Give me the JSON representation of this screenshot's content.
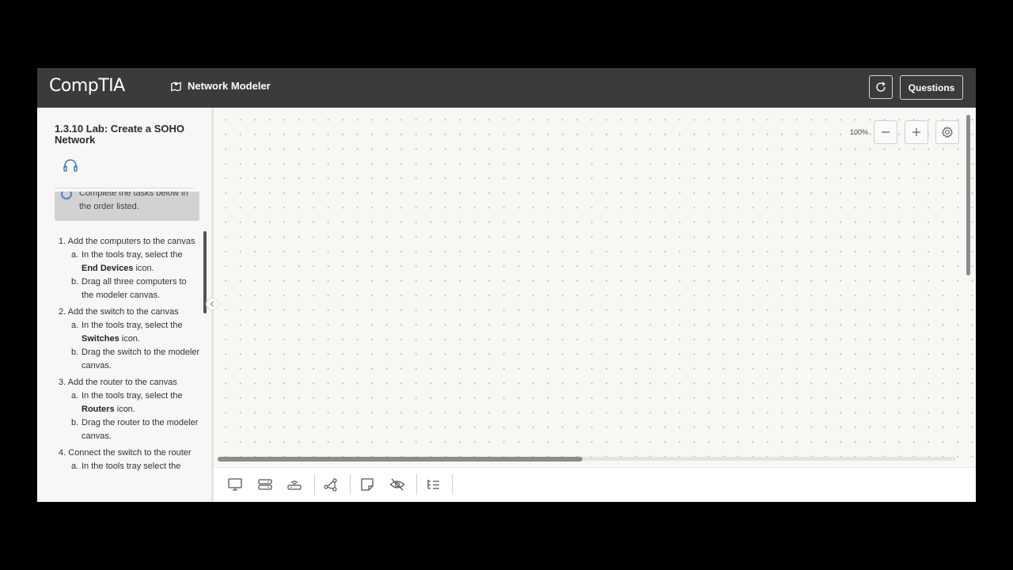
{
  "header": {
    "logo_text": "CompTIA",
    "app_name": "Network Modeler",
    "questions_label": "Questions",
    "icons": {
      "app": "network-map-icon",
      "reset": "refresh-icon"
    }
  },
  "sidebar": {
    "lab_title": "1.3.10 Lab: Create a SOHO Network",
    "note_text": "Complete the tasks below in the order listed.",
    "tasks": [
      {
        "number": "1.",
        "title": "Add the computers to the canvas",
        "steps": [
          {
            "letter": "a.",
            "pre": "In the tools tray, select the ",
            "bold": "End Devices",
            "post": " icon."
          },
          {
            "letter": "b.",
            "pre": "Drag all three computers to the modeler canvas.",
            "bold": "",
            "post": ""
          }
        ]
      },
      {
        "number": "2.",
        "title": "Add the switch to the canvas",
        "steps": [
          {
            "letter": "a.",
            "pre": "In the tools tray, select the ",
            "bold": "Switches",
            "post": " icon."
          },
          {
            "letter": "b.",
            "pre": "Drag the switch to the modeler canvas.",
            "bold": "",
            "post": ""
          }
        ]
      },
      {
        "number": "3.",
        "title": "Add the router to the canvas",
        "steps": [
          {
            "letter": "a.",
            "pre": "In the tools tray, select the ",
            "bold": "Routers",
            "post": " icon."
          },
          {
            "letter": "b.",
            "pre": "Drag the router to the modeler canvas.",
            "bold": "",
            "post": ""
          }
        ]
      },
      {
        "number": "4.",
        "title": "Connect the switch to the router",
        "steps": [
          {
            "letter": "a.",
            "pre": "In the tools tray select the",
            "bold": "",
            "post": ""
          }
        ]
      }
    ]
  },
  "canvas": {
    "zoom_level": "100%"
  },
  "tools_tray": [
    "end-devices-icon",
    "switches-icon",
    "routers-icon",
    "connection-icon",
    "note-icon",
    "hide-icon",
    "list-icon"
  ]
}
